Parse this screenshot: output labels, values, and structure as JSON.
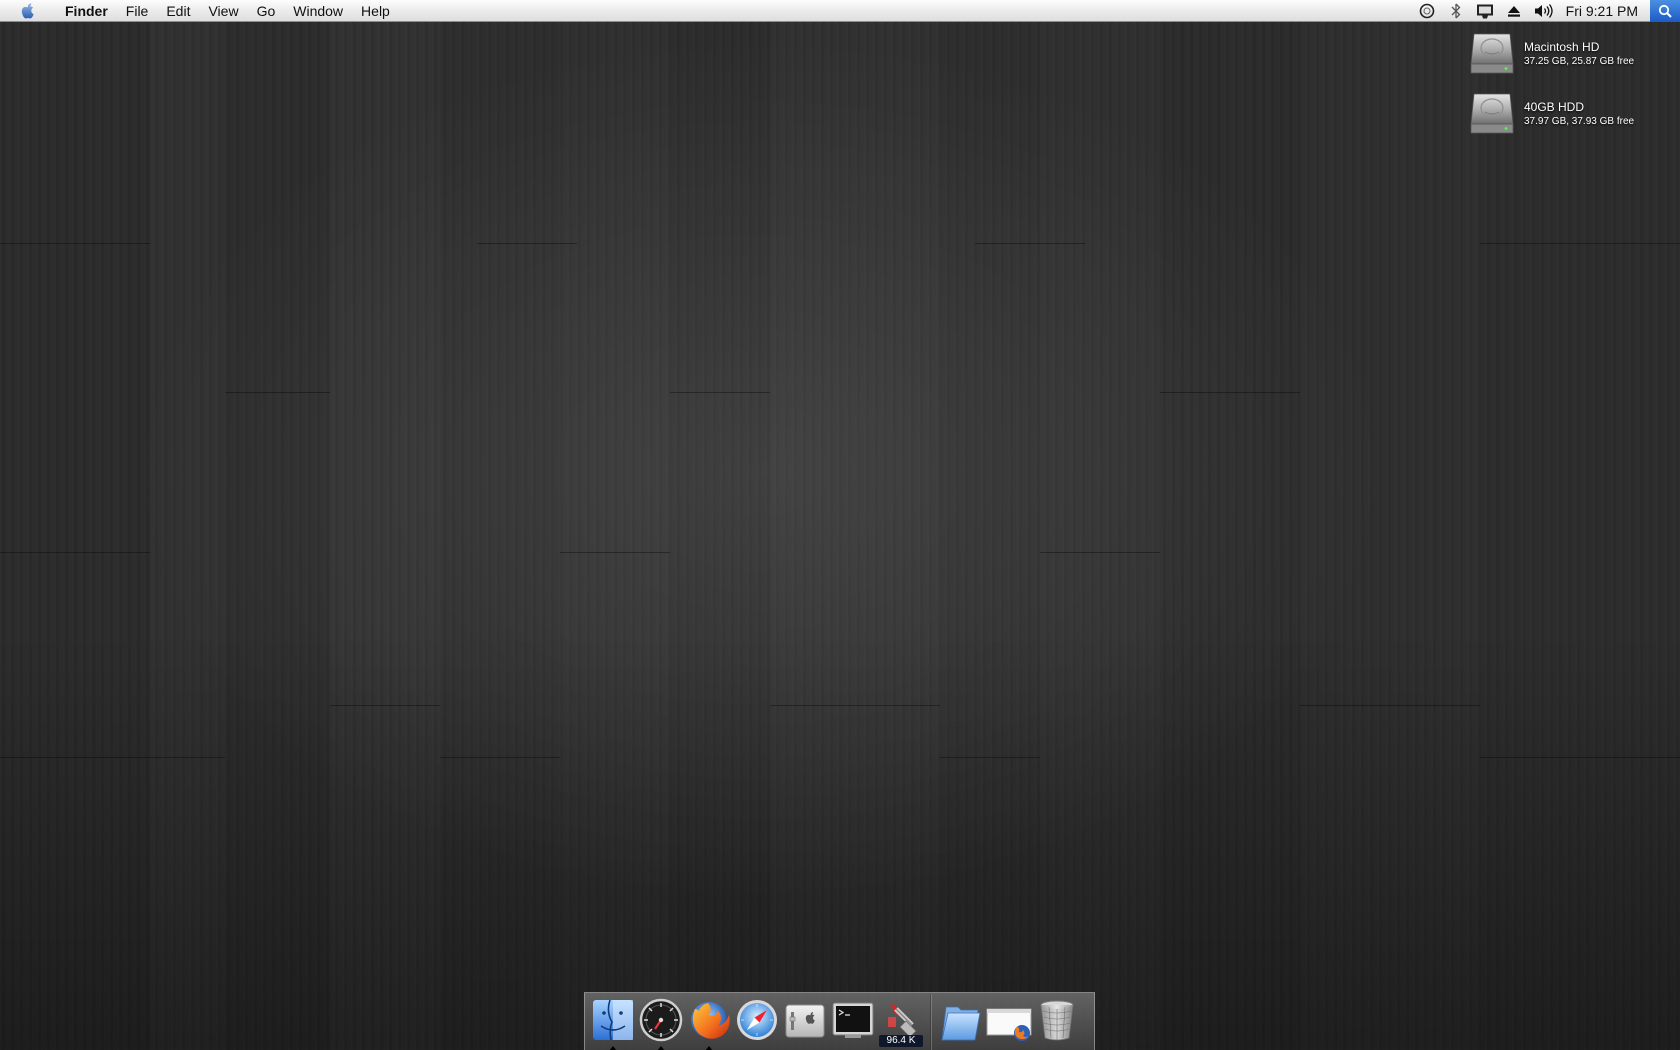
{
  "menubar": {
    "apple_icon": "apple-logo-icon",
    "app_name": "Finder",
    "menus": [
      "File",
      "Edit",
      "View",
      "Go",
      "Window",
      "Help"
    ],
    "status_icons": [
      "sync-icon",
      "bluetooth-icon",
      "display-icon",
      "eject-icon",
      "volume-icon"
    ],
    "clock": "Fri 9:21 PM",
    "spotlight_icon": "spotlight-icon"
  },
  "desktop": {
    "drives": [
      {
        "name": "Macintosh HD",
        "info": "37.25 GB, 25.87 GB free"
      },
      {
        "name": "40GB HDD",
        "info": "37.97 GB, 37.93 GB free"
      }
    ]
  },
  "dock": {
    "apps": [
      {
        "name": "Finder",
        "icon": "finder-icon",
        "running": true
      },
      {
        "name": "Dashboard",
        "icon": "dashboard-icon",
        "running": true
      },
      {
        "name": "Firefox",
        "icon": "firefox-icon",
        "running": true
      },
      {
        "name": "Safari",
        "icon": "safari-icon",
        "running": false
      },
      {
        "name": "System Preferences",
        "icon": "system-preferences-icon",
        "running": false
      },
      {
        "name": "Terminal",
        "icon": "terminal-icon",
        "running": false
      },
      {
        "name": "Activity Monitor",
        "icon": "activity-monitor-icon",
        "running": false,
        "badge": "96.4 K"
      }
    ],
    "others": [
      {
        "name": "Applications",
        "icon": "folder-icon"
      },
      {
        "name": "Downloads",
        "icon": "downloads-window-icon"
      },
      {
        "name": "Trash",
        "icon": "trash-icon"
      }
    ]
  }
}
